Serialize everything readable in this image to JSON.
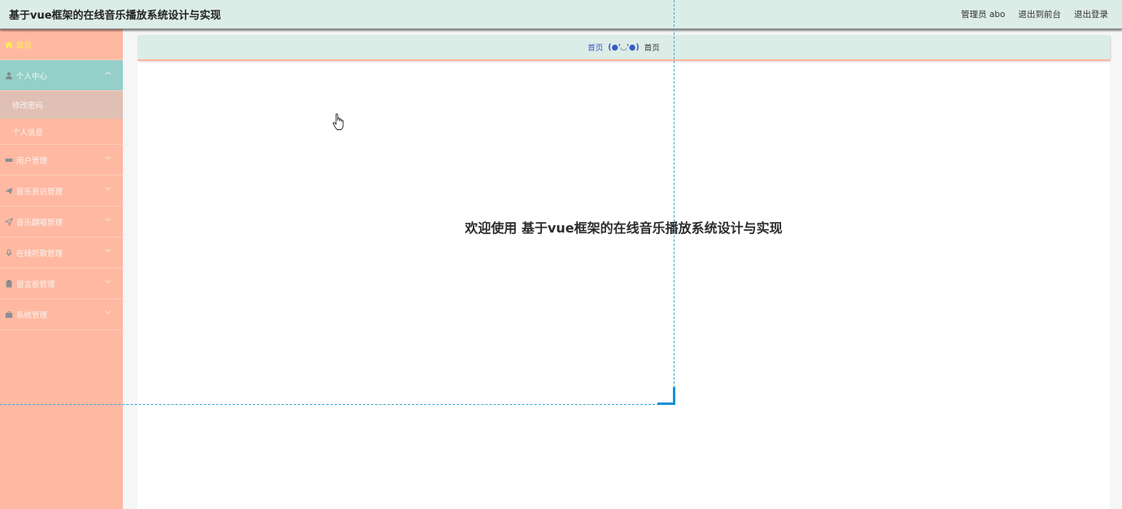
{
  "header": {
    "title": "基于vue框架的在线音乐播放系统设计与实现",
    "admin_label": "管理员 abo",
    "to_front": "退出到前台",
    "logout": "退出登录"
  },
  "sidebar": {
    "home": "首页",
    "personal_center": "个人中心",
    "change_password": "修改密码",
    "personal_info": "个人信息",
    "user_mgmt": "用户管理",
    "music_news_mgmt": "音乐资讯管理",
    "music_translate_mgmt": "音乐翻唱管理",
    "online_listen_mgmt": "在线听歌管理",
    "message_board_mgmt": "留言板管理",
    "system_mgmt": "系统管理"
  },
  "breadcrumb": {
    "home": "首页",
    "emote": "(●'◡'●)",
    "current": "首页"
  },
  "main": {
    "welcome": "欢迎使用 基于vue框架的在线音乐播放系统设计与实现"
  },
  "colors": {
    "topbar_bg": "#dcece7",
    "sidebar_bg": "#ffb9a2",
    "sidebar_open": "#94cfc9",
    "sidebar_active_sub": "#e0c0b4",
    "home_text": "#fff24a",
    "crumb_link": "#3a57c8"
  }
}
